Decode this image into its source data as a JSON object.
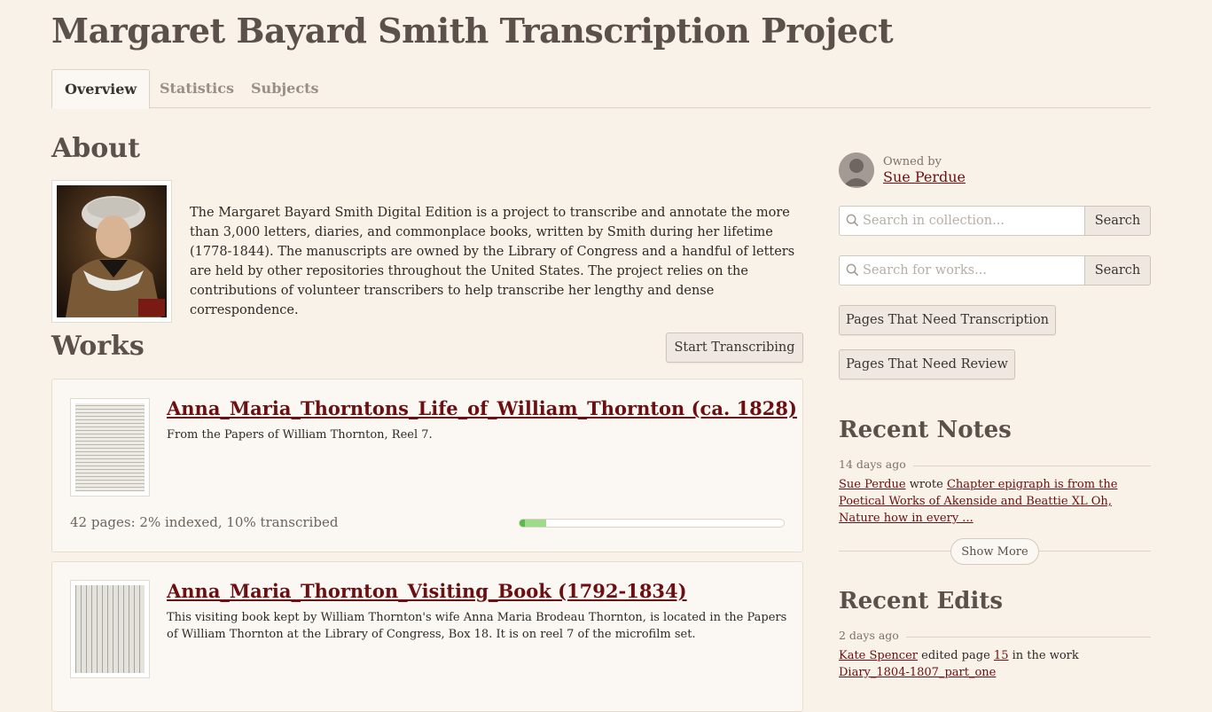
{
  "header": {
    "title": "Margaret Bayard Smith Transcription Project"
  },
  "tabs": [
    {
      "label": "Overview",
      "active": true
    },
    {
      "label": "Statistics",
      "active": false
    },
    {
      "label": "Subjects",
      "active": false
    }
  ],
  "about": {
    "heading": "About",
    "text": "The Margaret Bayard Smith Digital Edition is a project to transcribe and annotate the more than 3,000 letters, diaries, and commonplace books, written by Smith during her lifetime (1778-1844). The manuscripts are owned by the Library of Congress and a handful of letters are held by other repositories throughout the United States. The project relies on the contributions of volunteer transcribers to help transcribe her lengthy and dense correspondence."
  },
  "works": {
    "heading": "Works",
    "start_button": "Start Transcribing",
    "items": [
      {
        "title": "Anna_Maria_Thorntons_Life_of_William_Thornton (ca. 1828)",
        "description": "From the Papers of William Thornton, Reel 7.",
        "stats": "42 pages: 2% indexed, 10% transcribed",
        "indexed_pct": 2,
        "transcribed_pct": 10
      },
      {
        "title": "Anna_Maria_Thornton_Visiting_Book (1792-1834)",
        "description": "This visiting book kept by William Thornton's wife Anna Maria Brodeau Thornton, is located in the Papers of William Thornton at the Library of Congress, Box 18. It is on reel 7 of the microfilm set."
      }
    ]
  },
  "sidebar": {
    "owned_by_label": "Owned by",
    "owner_name": "Sue Perdue",
    "search_collection": {
      "placeholder": "Search in collection...",
      "button": "Search"
    },
    "search_works": {
      "placeholder": "Search for works...",
      "button": "Search"
    },
    "need_transcription_button": "Pages That Need Transcription",
    "need_review_button": "Pages That Need Review",
    "recent_notes": {
      "heading": "Recent Notes",
      "date": "14 days ago",
      "user": "Sue Perdue",
      "verb": "wrote",
      "note": "Chapter epigraph is from the Poetical Works of Akenside and Beattie XL Oh, Nature how in every ...",
      "show_more": "Show More"
    },
    "recent_edits": {
      "heading": "Recent Edits",
      "date": "2 days ago",
      "user": "Kate Spencer",
      "verb": "edited page",
      "page": "15",
      "in_the_work": "in the work",
      "work": "Diary_1804-1807_part_one"
    }
  },
  "colors": {
    "background": "#f8f2e8",
    "link": "#6b0f12",
    "heading": "#5c504a",
    "progress_indexed": "#5bb84a",
    "progress_transcribed": "#9fdb8c"
  }
}
